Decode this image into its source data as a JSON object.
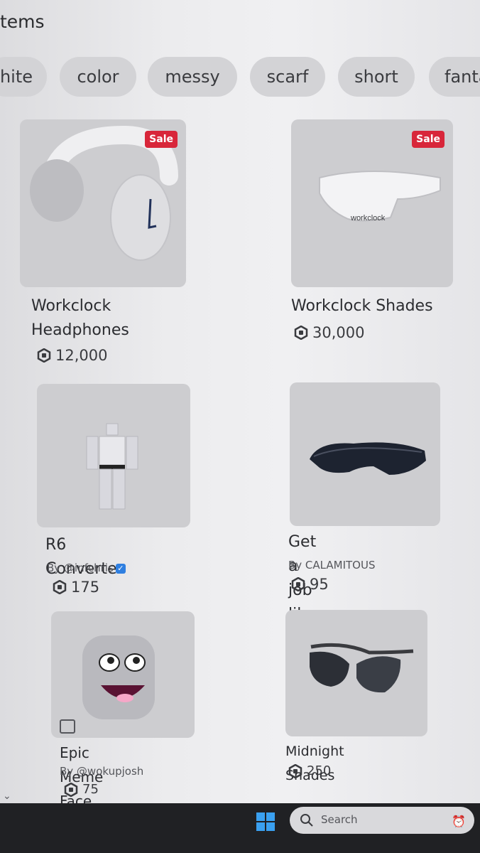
{
  "header": {
    "title": "tems"
  },
  "filters": [
    "hite",
    "color",
    "messy",
    "scarf",
    "short",
    "fanta"
  ],
  "items": [
    {
      "name": "Workclock Headphones",
      "sale": "Sale",
      "creator": "",
      "price": "12,000",
      "verified": false
    },
    {
      "name": "Workclock Shades",
      "sale": "Sale",
      "creator": "",
      "price": "30,000",
      "verified": false
    },
    {
      "name": "R6 Converter",
      "sale": "",
      "creator": "By @infchris",
      "price": "175",
      "verified": true
    },
    {
      "name": "Get a job lil bro",
      "sale": "",
      "creator": "By CALAMITOUS",
      "price": "95",
      "verified": false
    },
    {
      "name": "Epic Meme Face",
      "sale": "",
      "creator": "By @wokupjosh",
      "price": "75",
      "verified": false
    },
    {
      "name": "Midnight Shades",
      "sale": "",
      "creator": "",
      "price": "250",
      "verified": false
    }
  ],
  "thumb_labels": {
    "shades_print": "workclock"
  },
  "taskbar": {
    "search_placeholder": "Search"
  },
  "icons": {
    "currency": "robux-icon",
    "verified": "verified-badge-icon",
    "start": "windows-start-icon",
    "search": "search-icon"
  },
  "colors": {
    "sale_badge": "#d8263a",
    "verified": "#2f7fe0",
    "chip": "#d3d3d6",
    "thumb": "#cdcdd0"
  }
}
